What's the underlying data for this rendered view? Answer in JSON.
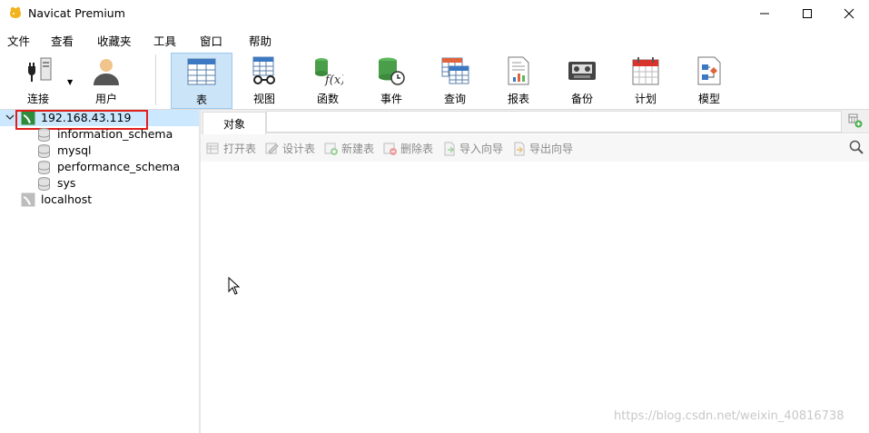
{
  "window": {
    "title": "Navicat Premium",
    "icon": "navicat-logo-icon"
  },
  "menu": [
    "文件",
    "查看",
    "收藏夹",
    "工具",
    "窗口",
    "帮助"
  ],
  "toolbar": {
    "connect": "连接",
    "user": "用户",
    "table": "表",
    "view": "视图",
    "function": "函数",
    "event": "事件",
    "query": "查询",
    "report": "报表",
    "backup": "备份",
    "schedule": "计划",
    "model": "模型",
    "active_tool": "表"
  },
  "tree": {
    "connection": "192.168.43.119",
    "databases": [
      "information_schema",
      "mysql",
      "performance_schema",
      "sys"
    ],
    "other_connection": "localhost"
  },
  "objects": {
    "tab": "对象",
    "actions": {
      "open": "打开表",
      "design": "设计表",
      "new": "新建表",
      "delete": "删除表",
      "import": "导入向导",
      "export": "导出向导"
    }
  },
  "watermark": "https://blog.csdn.net/weixin_40816738",
  "colors": {
    "selection": "#cce8ff",
    "highlight_box": "#e0201c",
    "active_tool": "#cce4f7"
  }
}
